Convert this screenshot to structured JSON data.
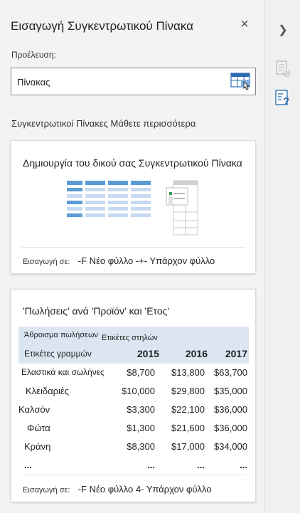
{
  "pane": {
    "title": "Εισαγωγή Συγκεντρωτικού Πίνακα",
    "close_glyph": "×",
    "source_label": "Προέλευση:",
    "source_value": "Πίνακας",
    "section_heading": "Συγκεντρωτικοί Πίνακες Μάθετε περισσότερα"
  },
  "card_own": {
    "title": "Δημιουργία του δικού σας Συγκεντρωτικού Πίνακα",
    "insert_label": "Εισαγωγή σε:",
    "insert_options": "-F Νέο φύλλο -+- Υπάρχον φύλλο"
  },
  "card_recommended": {
    "title": "'Πωλήσεις' ανά 'Προϊόν' και 'Ετος'",
    "sum_label": "Άθροισμα πωλήσεων",
    "column_labels": "Ετικέτες στηλών",
    "row_labels": "Ετικέτες γραμμών",
    "years": [
      "2015",
      "2016",
      "2017"
    ],
    "rows": [
      {
        "name": "Ελαστικά και σωλήνες",
        "values": [
          "$8,700",
          "$13,800",
          "$63,700"
        ]
      },
      {
        "name": "Κλειδαριές",
        "values": [
          "$10,000",
          "$29,800",
          "$35,000"
        ]
      },
      {
        "name": "Καλσόν",
        "values": [
          "$3,300",
          "$22,100",
          "$36,000"
        ]
      },
      {
        "name": "Φώτα",
        "values": [
          "$1,300",
          "$21,600",
          "$36,000"
        ]
      },
      {
        "name": "Κράνη",
        "values": [
          "$8,300",
          "$17,000",
          "$34,000"
        ]
      },
      {
        "name": "...",
        "values": [
          "...",
          "...",
          "..."
        ]
      }
    ],
    "insert_label": "Εισαγωγή σε:",
    "insert_options": "-F Νέο φύλλο 4- Υπάρχον φύλλο"
  },
  "rail": {
    "expand_glyph": "❯"
  },
  "colors": {
    "accent": "#2b6cb0",
    "pivot_header": "#dce6f2"
  },
  "icons": [
    "close-icon",
    "table-select-icon",
    "chevron-right-icon",
    "pivot-fields-icon",
    "pivot-help-icon"
  ]
}
